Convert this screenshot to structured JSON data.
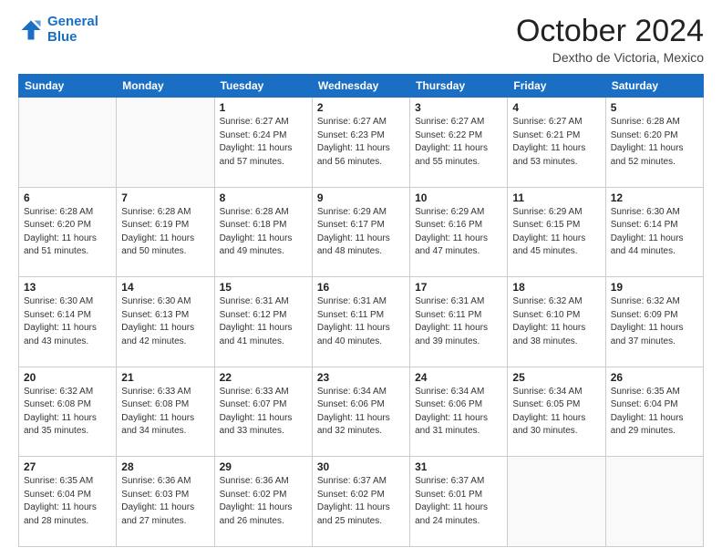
{
  "header": {
    "logo_line1": "General",
    "logo_line2": "Blue",
    "month_title": "October 2024",
    "location": "Dextho de Victoria, Mexico"
  },
  "days_of_week": [
    "Sunday",
    "Monday",
    "Tuesday",
    "Wednesday",
    "Thursday",
    "Friday",
    "Saturday"
  ],
  "weeks": [
    [
      {
        "day": "",
        "info": ""
      },
      {
        "day": "",
        "info": ""
      },
      {
        "day": "1",
        "info": "Sunrise: 6:27 AM\nSunset: 6:24 PM\nDaylight: 11 hours and 57 minutes."
      },
      {
        "day": "2",
        "info": "Sunrise: 6:27 AM\nSunset: 6:23 PM\nDaylight: 11 hours and 56 minutes."
      },
      {
        "day": "3",
        "info": "Sunrise: 6:27 AM\nSunset: 6:22 PM\nDaylight: 11 hours and 55 minutes."
      },
      {
        "day": "4",
        "info": "Sunrise: 6:27 AM\nSunset: 6:21 PM\nDaylight: 11 hours and 53 minutes."
      },
      {
        "day": "5",
        "info": "Sunrise: 6:28 AM\nSunset: 6:20 PM\nDaylight: 11 hours and 52 minutes."
      }
    ],
    [
      {
        "day": "6",
        "info": "Sunrise: 6:28 AM\nSunset: 6:20 PM\nDaylight: 11 hours and 51 minutes."
      },
      {
        "day": "7",
        "info": "Sunrise: 6:28 AM\nSunset: 6:19 PM\nDaylight: 11 hours and 50 minutes."
      },
      {
        "day": "8",
        "info": "Sunrise: 6:28 AM\nSunset: 6:18 PM\nDaylight: 11 hours and 49 minutes."
      },
      {
        "day": "9",
        "info": "Sunrise: 6:29 AM\nSunset: 6:17 PM\nDaylight: 11 hours and 48 minutes."
      },
      {
        "day": "10",
        "info": "Sunrise: 6:29 AM\nSunset: 6:16 PM\nDaylight: 11 hours and 47 minutes."
      },
      {
        "day": "11",
        "info": "Sunrise: 6:29 AM\nSunset: 6:15 PM\nDaylight: 11 hours and 45 minutes."
      },
      {
        "day": "12",
        "info": "Sunrise: 6:30 AM\nSunset: 6:14 PM\nDaylight: 11 hours and 44 minutes."
      }
    ],
    [
      {
        "day": "13",
        "info": "Sunrise: 6:30 AM\nSunset: 6:14 PM\nDaylight: 11 hours and 43 minutes."
      },
      {
        "day": "14",
        "info": "Sunrise: 6:30 AM\nSunset: 6:13 PM\nDaylight: 11 hours and 42 minutes."
      },
      {
        "day": "15",
        "info": "Sunrise: 6:31 AM\nSunset: 6:12 PM\nDaylight: 11 hours and 41 minutes."
      },
      {
        "day": "16",
        "info": "Sunrise: 6:31 AM\nSunset: 6:11 PM\nDaylight: 11 hours and 40 minutes."
      },
      {
        "day": "17",
        "info": "Sunrise: 6:31 AM\nSunset: 6:11 PM\nDaylight: 11 hours and 39 minutes."
      },
      {
        "day": "18",
        "info": "Sunrise: 6:32 AM\nSunset: 6:10 PM\nDaylight: 11 hours and 38 minutes."
      },
      {
        "day": "19",
        "info": "Sunrise: 6:32 AM\nSunset: 6:09 PM\nDaylight: 11 hours and 37 minutes."
      }
    ],
    [
      {
        "day": "20",
        "info": "Sunrise: 6:32 AM\nSunset: 6:08 PM\nDaylight: 11 hours and 35 minutes."
      },
      {
        "day": "21",
        "info": "Sunrise: 6:33 AM\nSunset: 6:08 PM\nDaylight: 11 hours and 34 minutes."
      },
      {
        "day": "22",
        "info": "Sunrise: 6:33 AM\nSunset: 6:07 PM\nDaylight: 11 hours and 33 minutes."
      },
      {
        "day": "23",
        "info": "Sunrise: 6:34 AM\nSunset: 6:06 PM\nDaylight: 11 hours and 32 minutes."
      },
      {
        "day": "24",
        "info": "Sunrise: 6:34 AM\nSunset: 6:06 PM\nDaylight: 11 hours and 31 minutes."
      },
      {
        "day": "25",
        "info": "Sunrise: 6:34 AM\nSunset: 6:05 PM\nDaylight: 11 hours and 30 minutes."
      },
      {
        "day": "26",
        "info": "Sunrise: 6:35 AM\nSunset: 6:04 PM\nDaylight: 11 hours and 29 minutes."
      }
    ],
    [
      {
        "day": "27",
        "info": "Sunrise: 6:35 AM\nSunset: 6:04 PM\nDaylight: 11 hours and 28 minutes."
      },
      {
        "day": "28",
        "info": "Sunrise: 6:36 AM\nSunset: 6:03 PM\nDaylight: 11 hours and 27 minutes."
      },
      {
        "day": "29",
        "info": "Sunrise: 6:36 AM\nSunset: 6:02 PM\nDaylight: 11 hours and 26 minutes."
      },
      {
        "day": "30",
        "info": "Sunrise: 6:37 AM\nSunset: 6:02 PM\nDaylight: 11 hours and 25 minutes."
      },
      {
        "day": "31",
        "info": "Sunrise: 6:37 AM\nSunset: 6:01 PM\nDaylight: 11 hours and 24 minutes."
      },
      {
        "day": "",
        "info": ""
      },
      {
        "day": "",
        "info": ""
      }
    ]
  ]
}
